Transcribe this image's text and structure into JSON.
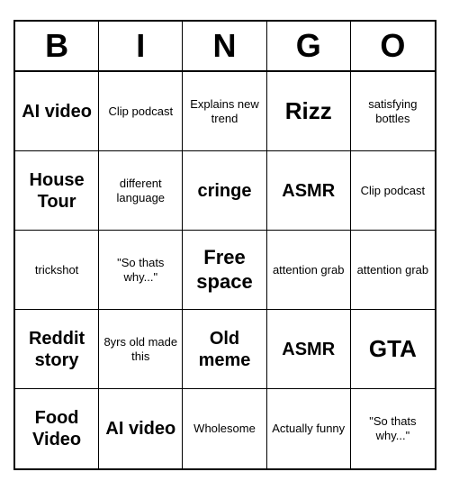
{
  "header": {
    "letters": [
      "B",
      "I",
      "N",
      "G",
      "O"
    ]
  },
  "cells": [
    {
      "text": "AI video",
      "size": "large"
    },
    {
      "text": "Clip podcast",
      "size": "normal"
    },
    {
      "text": "Explains new trend",
      "size": "normal"
    },
    {
      "text": "Rizz",
      "size": "xl"
    },
    {
      "text": "satisfying bottles",
      "size": "normal"
    },
    {
      "text": "House Tour",
      "size": "large"
    },
    {
      "text": "different language",
      "size": "normal"
    },
    {
      "text": "cringe",
      "size": "large"
    },
    {
      "text": "ASMR",
      "size": "large"
    },
    {
      "text": "Clip podcast",
      "size": "normal"
    },
    {
      "text": "trickshot",
      "size": "normal"
    },
    {
      "text": "\"So thats why...\"",
      "size": "normal"
    },
    {
      "text": "Free space",
      "size": "free"
    },
    {
      "text": "attention grab",
      "size": "normal"
    },
    {
      "text": "attention grab",
      "size": "normal"
    },
    {
      "text": "Reddit story",
      "size": "large"
    },
    {
      "text": "8yrs old made this",
      "size": "normal"
    },
    {
      "text": "Old meme",
      "size": "large"
    },
    {
      "text": "ASMR",
      "size": "large"
    },
    {
      "text": "GTA",
      "size": "xl"
    },
    {
      "text": "Food Video",
      "size": "large"
    },
    {
      "text": "AI video",
      "size": "large"
    },
    {
      "text": "Wholesome",
      "size": "normal"
    },
    {
      "text": "Actually funny",
      "size": "normal"
    },
    {
      "text": "\"So thats why...\"",
      "size": "normal"
    }
  ]
}
